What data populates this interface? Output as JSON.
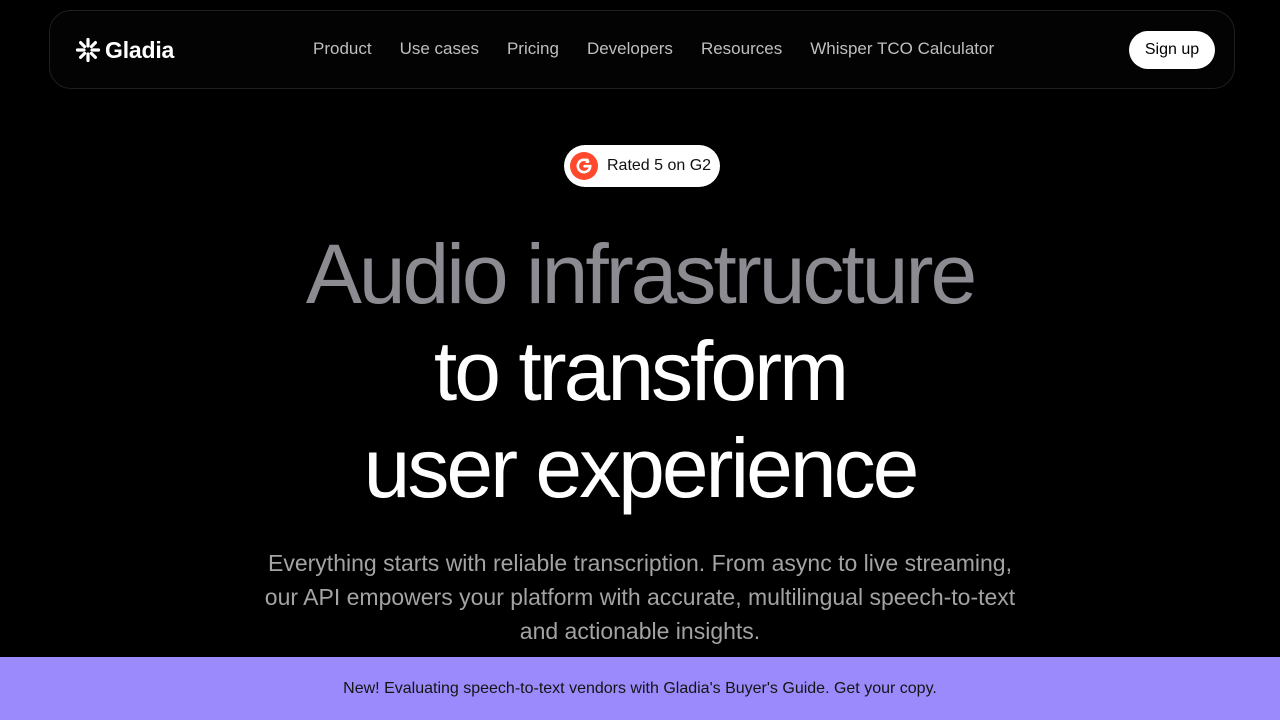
{
  "nav": {
    "logo_text": "Gladia",
    "links": [
      {
        "label": "Product"
      },
      {
        "label": "Use cases"
      },
      {
        "label": "Pricing"
      },
      {
        "label": "Developers"
      },
      {
        "label": "Resources"
      },
      {
        "label": "Whisper TCO Calculator"
      }
    ],
    "signup_label": "Sign up"
  },
  "badge": {
    "icon": "g2-icon",
    "text": "Rated 5 on G2"
  },
  "hero": {
    "line1": "Audio infrastructure",
    "line2": "to transform",
    "line3": "user experience"
  },
  "subtitle": {
    "line1": "Everything starts with reliable transcription. From async to live streaming,",
    "line2": "our API empowers your platform with accurate, multilingual speech-to-text",
    "line3": "and actionable insights."
  },
  "banner": {
    "text": "New! Evaluating speech-to-text vendors with Gladia's Buyer's Guide. Get your copy."
  },
  "colors": {
    "background": "#000000",
    "hero_dim": "#8c8b91",
    "banner": "#9b8afb",
    "g2_red": "#ff492c"
  }
}
